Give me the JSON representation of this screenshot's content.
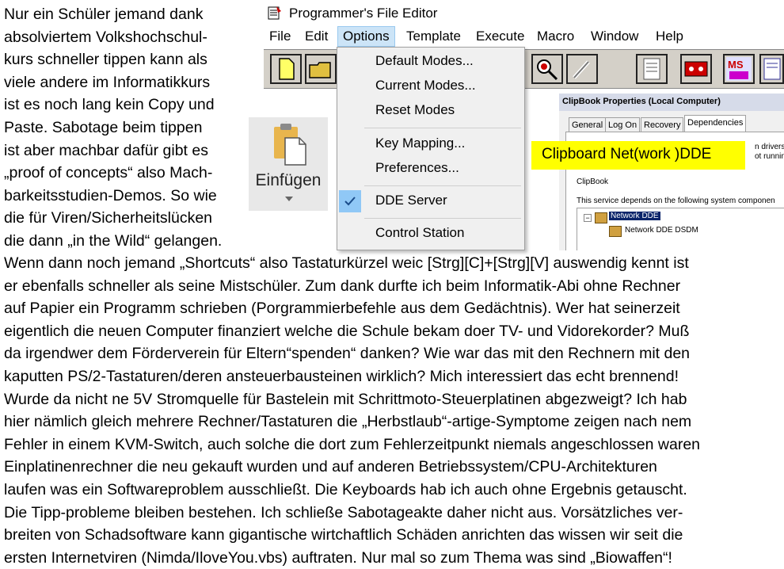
{
  "left_paragraph": [
    "Nur ein Schüler jemand dank",
    "absolviertem Volkshochschul-",
    "kurs schneller tippen kann als",
    "viele andere im Informatikkurs",
    "ist es noch lang kein Copy und",
    "Paste. Sabotage beim tippen",
    "ist aber machbar dafür gibt es",
    "„proof of concepts“ also Mach-",
    "barkeitsstudien-Demos. So wie",
    "die für Viren/Sicherheitslücken",
    "die dann „in the Wild“ gelangen."
  ],
  "bottom_paragraph": [
    "Wenn dann noch jemand „Shortcuts“ also Tastaturkürzel weic [Strg][C]+[Strg][V] auswendig kennt ist",
    "er ebenfalls schneller als seine Mistschüler. Zum dank durfte ich beim Informatik-Abi ohne Rechner",
    "auf Papier ein Programm schrieben (Porgrammierbefehle aus dem Gedächtnis). Wer hat seinerzeit",
    "eigentlich die neuen Computer finanziert welche die Schule bekam doer TV- und Vidorekorder? Muß",
    "da irgendwer dem Förderverein für Eltern“spenden“ danken? Wie war das mit den Rechnern mit den",
    "kaputten PS/2-Tastaturen/deren ansteuerbausteinen wirklich? Mich interessiert das echt brennend!",
    "Wurde da nicht ne 5V Stromquelle für Bastelein mit Schrittmoto-Steuerplatinen abgezweigt? Ich hab",
    "hier nämlich gleich mehrere Rechner/Tastaturen die „Herbstlaub“-artige-Symptome zeigen nach nem",
    "Fehler in einem KVM-Switch, auch solche die dort zum Fehlerzeitpunkt niemals angeschlossen waren",
    "Einplatinenrechner die neu gekauft wurden und auf anderen Betriebssystem/CPU-Architekturen",
    "laufen was ein Softwareproblem ausschließt. Die Keyboards hab ich auch ohne Ergebnis getauscht.",
    "Die Tipp-probleme bleiben bestehen. Ich schließe Sabotageakte daher nicht aus. Vorsätzliches ver-",
    "breiten von Schadsoftware kann gigantische wirtchaftlich Schäden anrichten das wissen wir seit die",
    "ersten Internetviren (Nimda/IloveYou.vbs) auftraten. Nur mal so zum Thema was sind „Biowaffen“!"
  ],
  "paste_button": {
    "label": "Einfügen",
    "icon": "clipboard-paste-icon"
  },
  "pfe": {
    "title": "Programmer's File Editor",
    "menu": [
      "File",
      "Edit",
      "Options",
      "Template",
      "Execute",
      "Macro",
      "Window",
      "Help"
    ],
    "active_menu": "Options",
    "options_menu": {
      "items": [
        "Default Modes...",
        "Current Modes...",
        "Reset Modes",
        "Key Mapping...",
        "Preferences...",
        "DDE Server",
        "Control Station"
      ],
      "checked": "DDE Server"
    },
    "toolbar_icons": [
      "new-file-icon",
      "open-folder-icon",
      "search-icon",
      "tools-icon",
      "notepad-icon",
      "tape-icon",
      "ms-dos-icon",
      "text-file-icon"
    ],
    "toolbar_labels": {
      "msdos": "MS"
    }
  },
  "clipbook": {
    "title": "ClipBook Properties (Local Computer)",
    "tabs": [
      "General",
      "Log On",
      "Recovery",
      "Dependencies"
    ],
    "active_tab": "Dependencies",
    "text_top1": "n drivers a",
    "text_top2": "ot runnin",
    "service_name": "ClipBook",
    "depends_text": "This service depends on the following system componen",
    "tree": [
      "Network DDE",
      "Network DDE DSDM"
    ]
  },
  "annotation": {
    "label": "Clipboard Net(work )DDE",
    "color": "#ffff00"
  }
}
